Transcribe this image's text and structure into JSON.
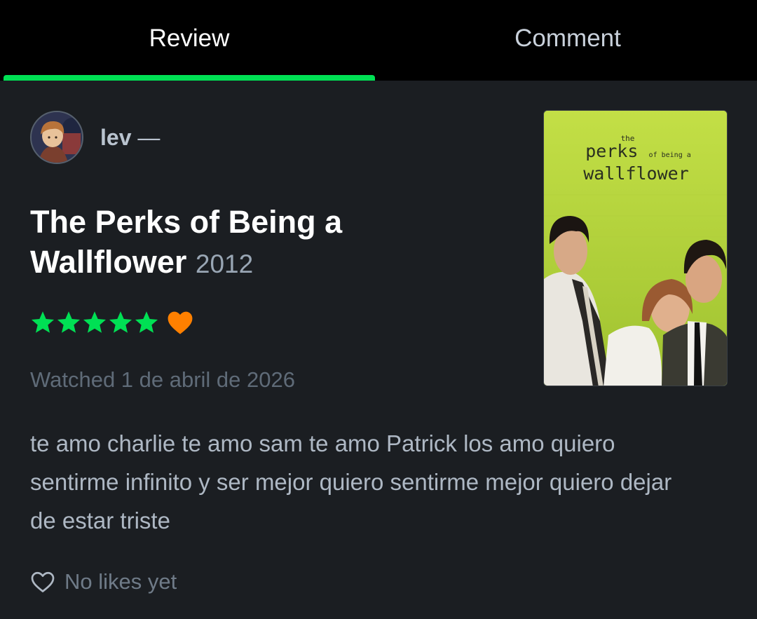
{
  "tabs": {
    "review": "Review",
    "comment": "Comment"
  },
  "author": {
    "name": "lev",
    "dash": "—"
  },
  "film": {
    "title": "The Perks of Being a Wallflower",
    "year": "2012"
  },
  "poster": {
    "line_the": "the",
    "line_perks": "perks",
    "line_of_being_a": "of being a",
    "line_wallflower": "wallflower"
  },
  "rating": {
    "stars": 5,
    "max_stars": 5,
    "liked": true
  },
  "watched": "Watched 1 de abril de 2026",
  "review": {
    "text": "te amo charlie te amo sam te amo Patrick los amo quiero sentirme infinito y ser mejor quiero sentirme mejor quiero dejar de estar triste"
  },
  "likes": {
    "text": "No likes yet"
  },
  "colors": {
    "accent": "#00e054",
    "like_heart": "#ff8000",
    "background": "#1b1e22",
    "tabbar": "#000000"
  }
}
